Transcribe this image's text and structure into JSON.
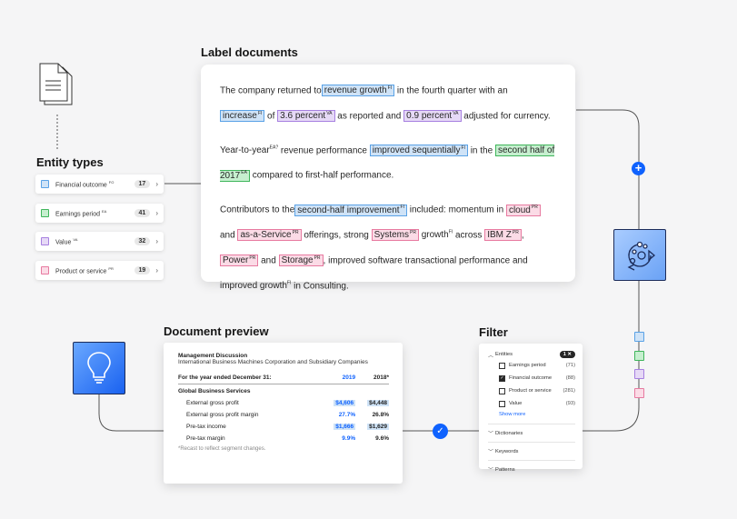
{
  "titles": {
    "label_documents": "Label documents",
    "entity_types": "Entity types",
    "document_preview": "Document preview",
    "filter": "Filter"
  },
  "label_doc": {
    "p1_a": "The company returned to",
    "p1_t1": "revenue  growth",
    "p1_t1_sup": "FI",
    "p1_b": " in the fourth quarter with an",
    "p1_t2": "increase",
    "p1_t2_sup": "FI",
    "p1_c": " of ",
    "p1_t3": "3.6 percent",
    "p1_t3_sup": "VA",
    "p1_d": " as reported and ",
    "p1_t4": "0.9 percent",
    "p1_t4_sup": "VA",
    "p1_e": " adjusted for currency.",
    "p2_a": "Year-to-year",
    "p2_a_sup": "EA?",
    "p2_b": "  revenue performance ",
    "p2_t1": "improved sequentially",
    "p2_t1_sup": "FI",
    "p2_c": " in the ",
    "p2_t2": "second half of 2017",
    "p2_t2_sup": "EA",
    "p2_d": " compared to first-half performance.",
    "p3_a": "Contributors to the",
    "p3_t1": "second-half  improvement",
    "p3_t1_sup": "FI",
    "p3_b": " included: momentum in ",
    "p3_t2": "cloud",
    "p3_t2_sup": "PR",
    "p3_c": " and ",
    "p3_t3": "as-a-Service",
    "p3_t3_sup": "PR",
    "p3_d": " offerings, strong ",
    "p3_t4": "Systems",
    "p3_t4_sup": "PR",
    "p3_e": "  growth",
    "p3_e_sup": "FI",
    "p3_f": "  across ",
    "p3_t5": "IBM Z",
    "p3_t5_sup": "PR",
    "p3_g": ",",
    "p3_t6": "Power",
    "p3_t6_sup": "PR",
    "p3_h": " and ",
    "p3_t7": "Storage",
    "p3_t7_sup": "PR",
    "p3_i": ", improved software transactional performance and",
    "p3_j": "improved  growth",
    "p3_j_sup": "FI",
    "p3_k": "  in Consulting."
  },
  "entity_types": [
    {
      "label": "Financial outcome",
      "abbr": "FO",
      "count": "17",
      "color": "#5aa2e6",
      "fill": "#cfe3f7"
    },
    {
      "label": "Earnings period",
      "abbr": "EA",
      "count": "41",
      "color": "#3fb55b",
      "fill": "#c6efcf"
    },
    {
      "label": "Value",
      "abbr": "VA",
      "count": "32",
      "color": "#a780e0",
      "fill": "#e6d9f6"
    },
    {
      "label": "Product or service",
      "abbr": "PR",
      "count": "19",
      "color": "#e77aa0",
      "fill": "#fbdbe6"
    }
  ],
  "preview": {
    "heading": "Management Discussion",
    "subheading": "International Business Machines Corporation and Subsidiary Companies",
    "col_label": "For the year ended December 31:",
    "col_2019": "2019",
    "col_2018": "2018*",
    "section": "Global Business Services",
    "rows": [
      {
        "label": "External gross profit",
        "v2019": "$4,606",
        "v2018": "$4,448"
      },
      {
        "label": "External gross profit margin",
        "v2019": "27.7%",
        "v2018": "26.8%"
      },
      {
        "label": "Pre-tax income",
        "v2019": "$1,666",
        "v2018": "$1,629"
      },
      {
        "label": "Pre-tax margin",
        "v2019": "9.9%",
        "v2018": "9.6%"
      }
    ],
    "note": "*Recast to reflect segment changes."
  },
  "filter": {
    "entities_label": "Entities",
    "entities_badge": "1 ✕",
    "options": [
      {
        "label": "Earnings period",
        "count": "(71)",
        "checked": false
      },
      {
        "label": "Financial outcome",
        "count": "(88)",
        "checked": true
      },
      {
        "label": "Product or service",
        "count": "(281)",
        "checked": false
      },
      {
        "label": "Value",
        "count": "(93)",
        "checked": false
      }
    ],
    "show_more": "Show more",
    "dictionaries": "Dictionaries",
    "keywords": "Keywords",
    "patterns": "Patterns"
  },
  "colors": {
    "accent": "#0f62fe",
    "wire": "#555555"
  }
}
